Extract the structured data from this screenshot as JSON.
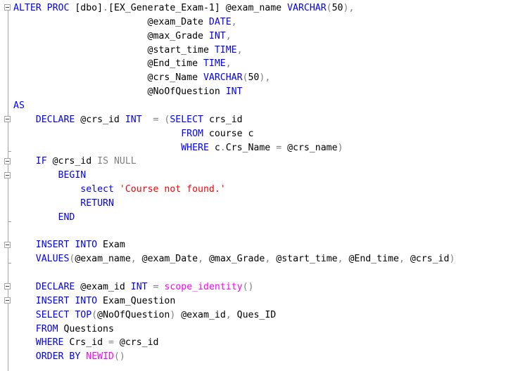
{
  "editor": {
    "lines": [
      [
        [
          "kw",
          "ALTER PROC "
        ],
        [
          "tx",
          "[dbo]"
        ],
        [
          "gr",
          "."
        ],
        [
          "tx",
          "[EX_Generate_Exam-1] @exam_name "
        ],
        [
          "kw",
          "VARCHAR"
        ],
        [
          "gr",
          "("
        ],
        [
          "tx",
          "50"
        ],
        [
          "gr",
          "),"
        ]
      ],
      [
        [
          "tx",
          "                        @exam_Date "
        ],
        [
          "kw",
          "DATE"
        ],
        [
          "gr",
          ","
        ]
      ],
      [
        [
          "tx",
          "                        @max_Grade "
        ],
        [
          "kw",
          "INT"
        ],
        [
          "gr",
          ","
        ]
      ],
      [
        [
          "tx",
          "                        @start_time "
        ],
        [
          "kw",
          "TIME"
        ],
        [
          "gr",
          ","
        ]
      ],
      [
        [
          "tx",
          "                        @End_time "
        ],
        [
          "kw",
          "TIME"
        ],
        [
          "gr",
          ","
        ]
      ],
      [
        [
          "tx",
          "                        @crs_Name "
        ],
        [
          "kw",
          "VARCHAR"
        ],
        [
          "gr",
          "("
        ],
        [
          "tx",
          "50"
        ],
        [
          "gr",
          "),"
        ]
      ],
      [
        [
          "tx",
          "                        @NoOfQuestion "
        ],
        [
          "kw",
          "INT"
        ]
      ],
      [
        [
          "kw",
          "AS"
        ]
      ],
      [
        [
          "tx",
          "    "
        ],
        [
          "kw",
          "DECLARE"
        ],
        [
          "tx",
          " @crs_id "
        ],
        [
          "kw",
          "INT"
        ],
        [
          "tx",
          "  "
        ],
        [
          "gr",
          "= ("
        ],
        [
          "kw",
          "SELECT"
        ],
        [
          "tx",
          " crs_id"
        ]
      ],
      [
        [
          "tx",
          "                              "
        ],
        [
          "kw",
          "FROM"
        ],
        [
          "tx",
          " course c"
        ]
      ],
      [
        [
          "tx",
          "                              "
        ],
        [
          "kw",
          "WHERE"
        ],
        [
          "tx",
          " c"
        ],
        [
          "gr",
          "."
        ],
        [
          "tx",
          "Crs_Name "
        ],
        [
          "gr",
          "="
        ],
        [
          "tx",
          " @crs_name"
        ],
        [
          "gr",
          ")"
        ]
      ],
      [
        [
          "tx",
          "    "
        ],
        [
          "kw",
          "IF"
        ],
        [
          "tx",
          " @crs_id "
        ],
        [
          "gr",
          "IS NULL"
        ]
      ],
      [
        [
          "tx",
          "        "
        ],
        [
          "kw",
          "BEGIN"
        ]
      ],
      [
        [
          "tx",
          "            "
        ],
        [
          "kw",
          "select"
        ],
        [
          "tx",
          " "
        ],
        [
          "st",
          "'Course not found.'"
        ]
      ],
      [
        [
          "tx",
          "            "
        ],
        [
          "kw",
          "RETURN"
        ]
      ],
      [
        [
          "tx",
          "        "
        ],
        [
          "kw",
          "END"
        ]
      ],
      [],
      [
        [
          "tx",
          "    "
        ],
        [
          "kw",
          "INSERT INTO"
        ],
        [
          "tx",
          " Exam"
        ]
      ],
      [
        [
          "tx",
          "    "
        ],
        [
          "kw",
          "VALUES"
        ],
        [
          "gr",
          "("
        ],
        [
          "tx",
          "@exam_name"
        ],
        [
          "gr",
          ","
        ],
        [
          "tx",
          " @exam_Date"
        ],
        [
          "gr",
          ","
        ],
        [
          "tx",
          " @max_Grade"
        ],
        [
          "gr",
          ","
        ],
        [
          "tx",
          " @start_time"
        ],
        [
          "gr",
          ","
        ],
        [
          "tx",
          " @End_time"
        ],
        [
          "gr",
          ","
        ],
        [
          "tx",
          " @crs_id"
        ],
        [
          "gr",
          ")"
        ]
      ],
      [],
      [
        [
          "tx",
          "    "
        ],
        [
          "kw",
          "DECLARE"
        ],
        [
          "tx",
          " @exam_id "
        ],
        [
          "kw",
          "INT"
        ],
        [
          "tx",
          " "
        ],
        [
          "gr",
          "="
        ],
        [
          "tx",
          " "
        ],
        [
          "fn",
          "scope_identity"
        ],
        [
          "gr",
          "()"
        ]
      ],
      [
        [
          "tx",
          "    "
        ],
        [
          "kw",
          "INSERT INTO"
        ],
        [
          "tx",
          " Exam_Question"
        ]
      ],
      [
        [
          "tx",
          "    "
        ],
        [
          "kw",
          "SELECT TOP"
        ],
        [
          "gr",
          "("
        ],
        [
          "tx",
          "@NoOfQuestion"
        ],
        [
          "gr",
          ")"
        ],
        [
          "tx",
          " @exam_id"
        ],
        [
          "gr",
          ","
        ],
        [
          "tx",
          " Ques_ID"
        ]
      ],
      [
        [
          "tx",
          "    "
        ],
        [
          "kw",
          "FROM"
        ],
        [
          "tx",
          " Questions"
        ]
      ],
      [
        [
          "tx",
          "    "
        ],
        [
          "kw",
          "WHERE"
        ],
        [
          "tx",
          " Crs_id "
        ],
        [
          "gr",
          "="
        ],
        [
          "tx",
          " @crs_id"
        ]
      ],
      [
        [
          "tx",
          "    "
        ],
        [
          "kw",
          "ORDER BY"
        ],
        [
          "tx",
          " "
        ],
        [
          "fn",
          "NEWID"
        ],
        [
          "gr",
          "()"
        ]
      ]
    ]
  }
}
